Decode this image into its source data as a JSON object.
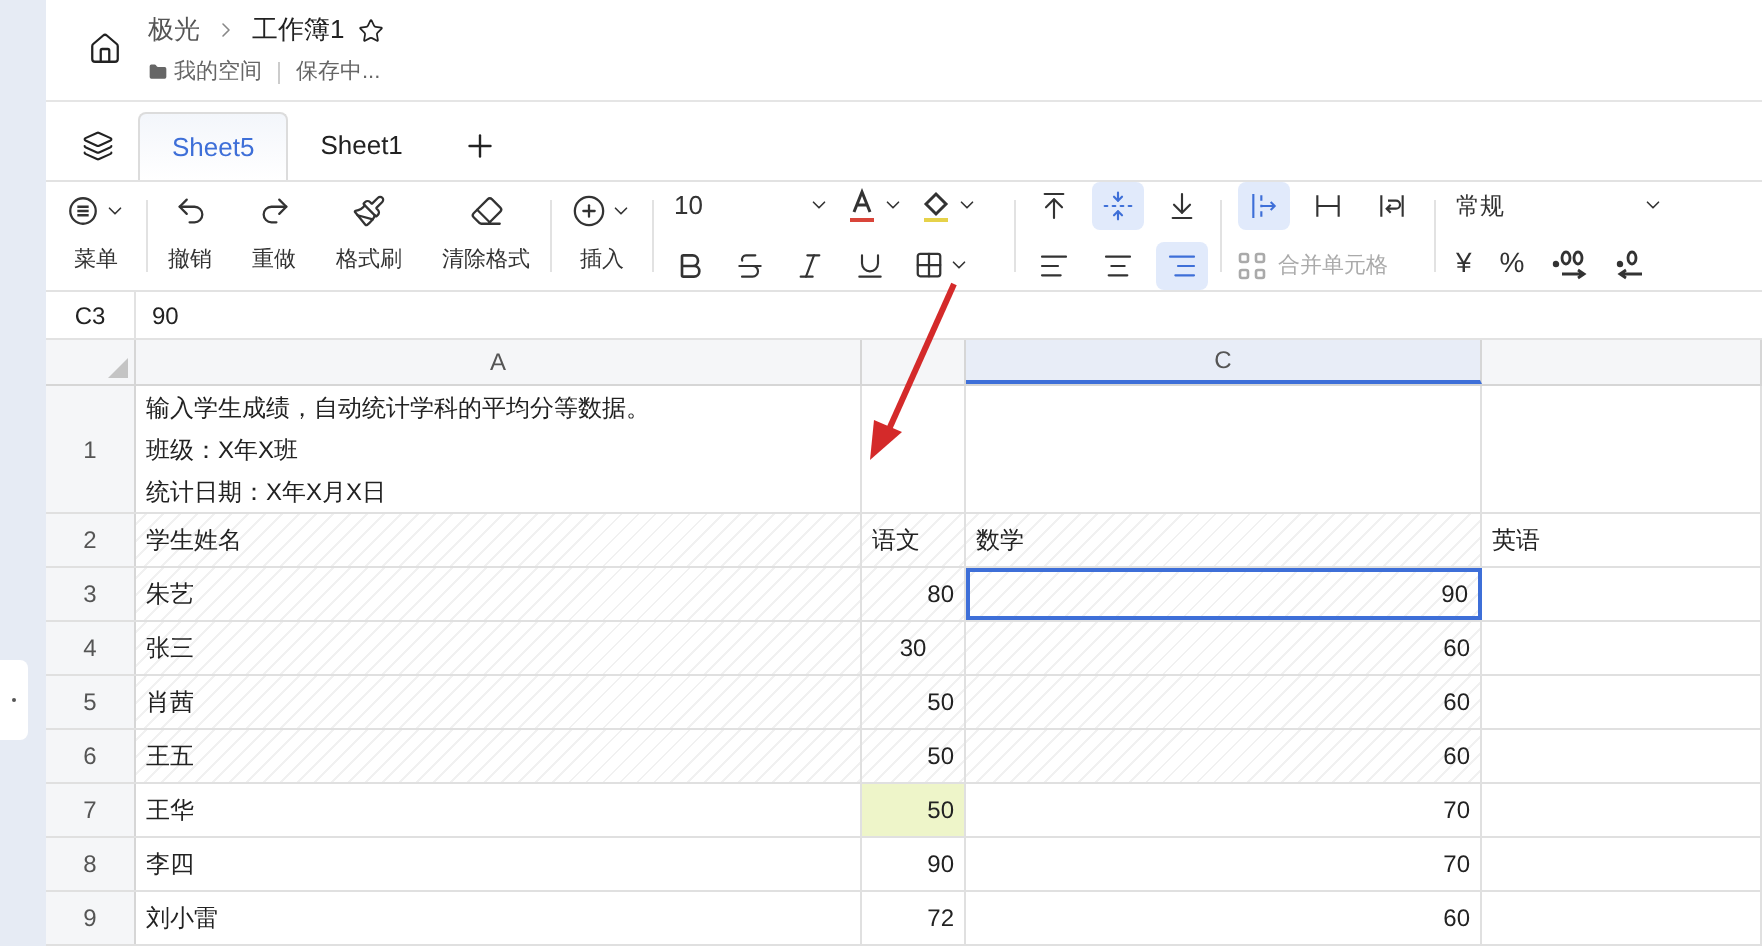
{
  "header": {
    "breadcrumb_root": "极光",
    "title": "工作簿1",
    "starred": false,
    "location": "我的空间",
    "status": "保存中..."
  },
  "tabs": [
    {
      "label": "Sheet5",
      "selected": true
    },
    {
      "label": "Sheet1",
      "selected": false
    }
  ],
  "toolbar": {
    "main_buttons": [
      {
        "kind": "menu",
        "label": "菜单",
        "dropdown": true
      },
      {
        "kind": "undo",
        "label": "撤销",
        "dropdown": false
      },
      {
        "kind": "redo",
        "label": "重做",
        "dropdown": false
      },
      {
        "kind": "painter",
        "label": "格式刷",
        "dropdown": false
      },
      {
        "kind": "clear",
        "label": "清除格式",
        "dropdown": false
      },
      {
        "kind": "insert",
        "label": "插入",
        "dropdown": true
      }
    ],
    "font_size": "10",
    "vertical_align": [
      {
        "kind": "top",
        "selected": false
      },
      {
        "kind": "middle",
        "selected": true
      },
      {
        "kind": "bottom",
        "selected": false
      }
    ],
    "horizontal_align": [
      {
        "kind": "left",
        "selected": false
      },
      {
        "kind": "center",
        "selected": false
      },
      {
        "kind": "right",
        "selected": true
      }
    ],
    "wrap": [
      {
        "kind": "overflow",
        "selected": true
      },
      {
        "kind": "clip",
        "selected": false
      },
      {
        "kind": "wrap",
        "selected": false
      }
    ],
    "merge": {
      "label": "合并单元格",
      "disabled": true
    },
    "number_format": "常规",
    "currency": "¥",
    "percent": "%"
  },
  "formula_bar": {
    "cell_ref": "C3",
    "value": "90"
  },
  "sheet": {
    "columns": [
      {
        "label": "A",
        "selected": false
      },
      {
        "selected": false
      },
      {
        "label": "C",
        "selected": true
      },
      {
        "selected": false
      }
    ],
    "rows": [
      {
        "number": "1",
        "hatched": false,
        "cells": [
          {
            "kind": "text",
            "lines": [
              "输入学生成绩，自动统计学科的平均分等数据。",
              "班级：X年X班",
              "统计日期：X年X月X日"
            ]
          },
          null,
          null,
          null
        ]
      },
      {
        "number": "2",
        "hatched": true,
        "cells": [
          {
            "kind": "text",
            "lines": [
              "学生姓名"
            ]
          },
          {
            "kind": "text",
            "lines": [
              "语文"
            ]
          },
          {
            "kind": "text",
            "lines": [
              "数学"
            ]
          },
          {
            "kind": "text",
            "lines": [
              "英语"
            ]
          }
        ]
      },
      {
        "number": "3",
        "hatched": true,
        "cells": [
          {
            "kind": "text",
            "lines": [
              "朱艺"
            ]
          },
          {
            "kind": "number",
            "lines": [
              "80"
            ]
          },
          {
            "kind": "number",
            "lines": [
              "90"
            ],
            "selected": true
          },
          null
        ]
      },
      {
        "number": "4",
        "hatched": true,
        "cells": [
          {
            "kind": "text",
            "lines": [
              "张三"
            ]
          },
          {
            "kind": "centered",
            "lines": [
              "30"
            ]
          },
          {
            "kind": "number",
            "lines": [
              "60"
            ]
          },
          null
        ]
      },
      {
        "number": "5",
        "hatched": true,
        "cells": [
          {
            "kind": "text",
            "lines": [
              "肖茜"
            ]
          },
          {
            "kind": "number",
            "lines": [
              "50"
            ]
          },
          {
            "kind": "number",
            "lines": [
              "60"
            ]
          },
          null
        ]
      },
      {
        "number": "6",
        "hatched": true,
        "cells": [
          {
            "kind": "text",
            "lines": [
              "王五"
            ]
          },
          {
            "kind": "number",
            "lines": [
              "50"
            ]
          },
          {
            "kind": "number",
            "lines": [
              "60"
            ]
          },
          null
        ]
      },
      {
        "number": "7",
        "hatched": false,
        "cells": [
          {
            "kind": "text",
            "lines": [
              "王华"
            ]
          },
          {
            "kind": "number",
            "lines": [
              "50"
            ],
            "color": "#eef5c9"
          },
          {
            "kind": "number",
            "lines": [
              "70"
            ]
          },
          null
        ]
      },
      {
        "number": "8",
        "hatched": false,
        "cells": [
          {
            "kind": "text",
            "lines": [
              "李四"
            ]
          },
          {
            "kind": "number",
            "lines": [
              "90"
            ]
          },
          {
            "kind": "number",
            "lines": [
              "70"
            ]
          },
          null
        ]
      },
      {
        "number": "9",
        "hatched": false,
        "cells": [
          {
            "kind": "text",
            "lines": [
              "刘小雷"
            ]
          },
          {
            "kind": "number",
            "lines": [
              "72"
            ]
          },
          {
            "kind": "number",
            "lines": [
              "60"
            ]
          },
          null
        ]
      }
    ]
  }
}
